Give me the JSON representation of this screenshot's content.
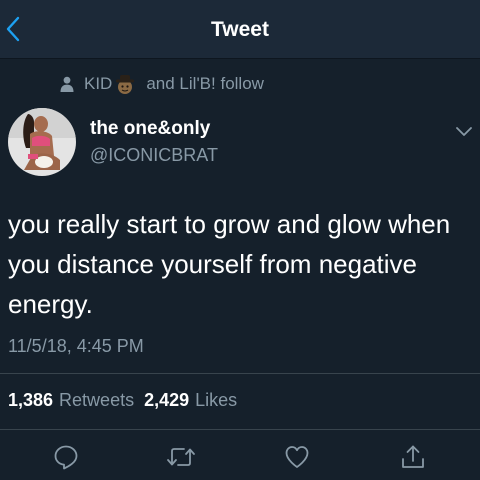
{
  "nav": {
    "title": "Tweet",
    "back_icon": "chevron-left-icon"
  },
  "social_context": {
    "icon": "person-icon",
    "first_name": "KID",
    "emoji": "cowboy-emoji",
    "rest": "and Lil'B! follow"
  },
  "author": {
    "display_name": "the one&only",
    "handle": "@ICONICBRAT",
    "menu_icon": "chevron-down-icon"
  },
  "tweet": {
    "lines": [
      "you really start to grow and glow when",
      "you distance yourself from negative",
      "energy."
    ],
    "timestamp": "11/5/18, 4:45 PM"
  },
  "stats": {
    "retweets_count": "1,386",
    "retweets_label": "Retweets",
    "likes_count": "2,429",
    "likes_label": "Likes"
  },
  "actions": [
    "reply-icon",
    "retweet-icon",
    "like-icon",
    "share-icon"
  ],
  "colors": {
    "background": "#15202b",
    "nav_background": "#1c2938",
    "accent": "#1da1f2",
    "secondary_text": "#8899a6",
    "divider": "#38444d"
  }
}
